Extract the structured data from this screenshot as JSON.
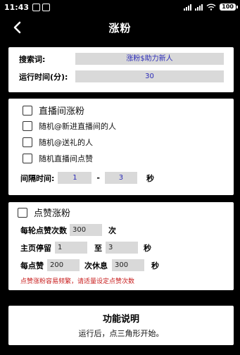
{
  "status_bar": {
    "time": "11:43",
    "battery": "100",
    "icons": [
      "app-icon",
      "app-icon",
      "signal-icon",
      "wifi-icon",
      "battery-icon"
    ]
  },
  "header": {
    "title": "涨粉",
    "back_icon": "back-arrow-icon"
  },
  "settings": {
    "keyword_label": "搜索词:",
    "keyword_value": "涨粉$助力新人",
    "runtime_label": "运行时间(分):",
    "runtime_value": "30"
  },
  "live_follow": {
    "title": "直播间涨粉",
    "options": [
      "随机@新进直播间的人",
      "随机@送礼的人",
      "随机直播间点赞"
    ],
    "interval_label": "间隔时间:",
    "interval_min": "1",
    "interval_dash": "-",
    "interval_max": "3",
    "interval_unit": "秒"
  },
  "like_follow": {
    "title": "点赞涨粉",
    "per_round_label": "每轮点赞次数",
    "per_round_value": "300",
    "per_round_unit": "次",
    "stay_label": "主页停留",
    "stay_min": "1",
    "stay_to": "至",
    "stay_max": "3",
    "stay_unit": "秒",
    "every_label": "每点赞",
    "every_value": "200",
    "rest_label": "次休息",
    "rest_value": "300",
    "rest_unit": "秒",
    "warning": "点赞涨粉容易频繁，请适量设定点赞次数"
  },
  "function_info": {
    "title": "功能说明",
    "description": "运行后，点三角形开始。"
  },
  "colors": {
    "background": "#000000",
    "card": "#ffffff",
    "input": "#d9d9d9",
    "input_text": "#2a2ab8",
    "warning": "#c81e1e"
  }
}
